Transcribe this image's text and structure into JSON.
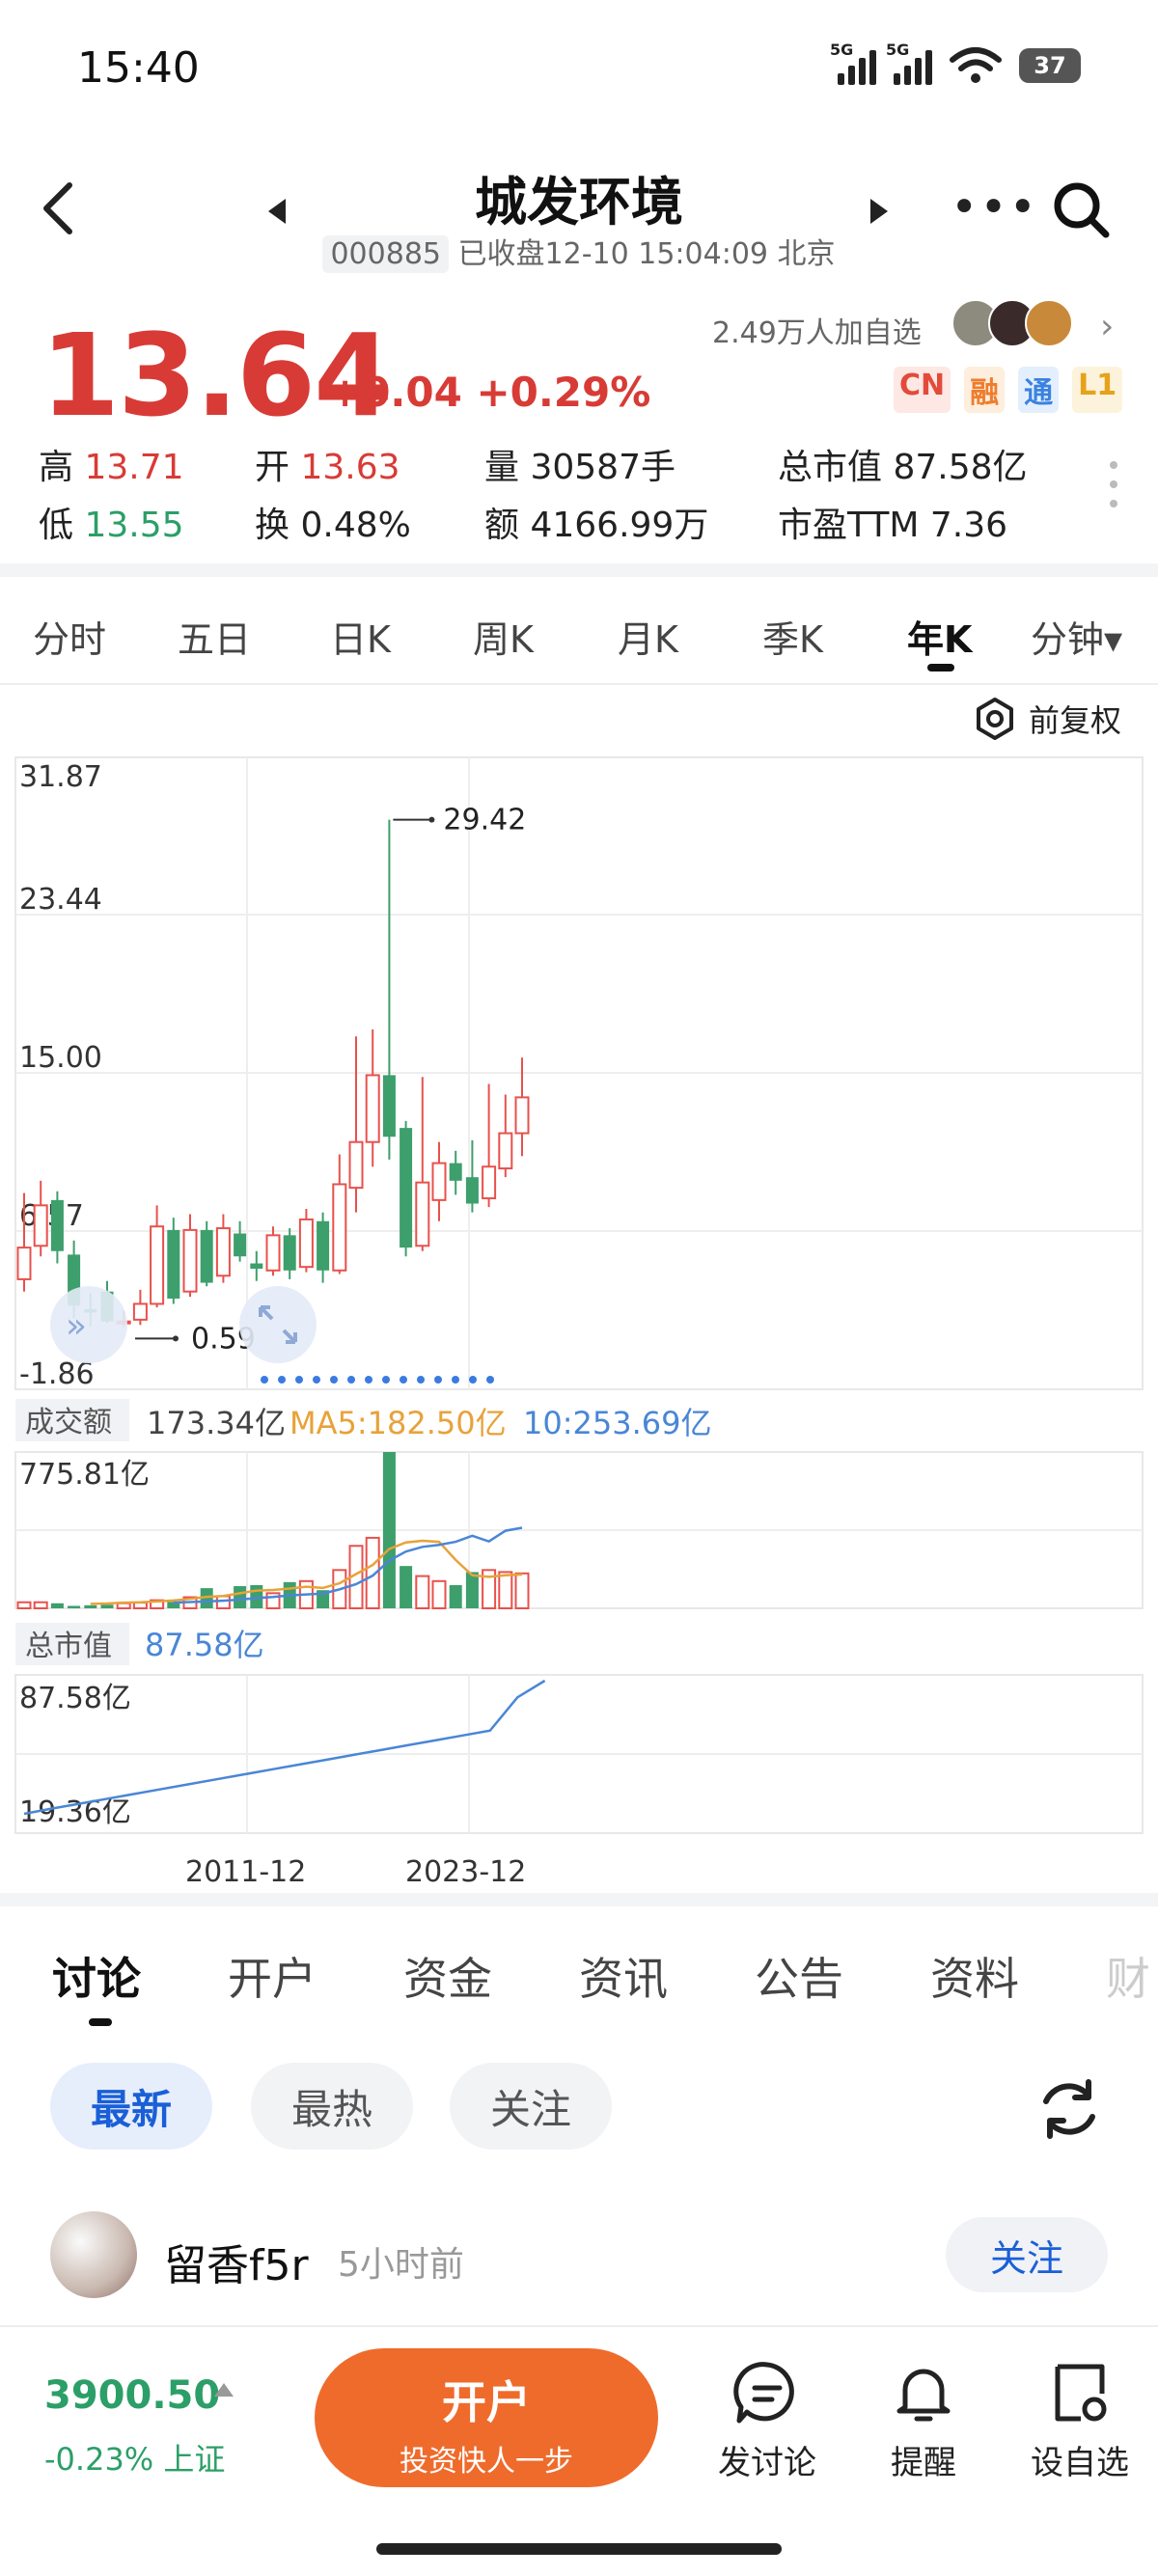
{
  "status_bar": {
    "time": "15:40",
    "signal1": "5G",
    "signal2": "5G",
    "battery": "37"
  },
  "header": {
    "title": "城发环境",
    "code": "000885",
    "status": "已收盘12-10 15:04:09 北京"
  },
  "quote": {
    "price": "13.64",
    "change": "+0.04 +0.29%",
    "watchers": "2.49万人加自选",
    "badges": [
      "CN",
      "融",
      "通",
      "L1"
    ],
    "stats": {
      "high_label": "高",
      "high": "13.71",
      "low_label": "低",
      "low": "13.55",
      "open_label": "开",
      "open": "13.63",
      "turnover_label": "换",
      "turnover": "0.48%",
      "volume_label": "量",
      "volume": "30587手",
      "amount_label": "额",
      "amount": "4166.99万",
      "mcap_label": "总市值",
      "mcap": "87.58亿",
      "pe_label": "市盈TTM",
      "pe": "7.36"
    }
  },
  "period_tabs": [
    "分时",
    "五日",
    "日K",
    "周K",
    "月K",
    "季K",
    "年K",
    "分钟▾"
  ],
  "active_period": "年K",
  "adjust_label": "前复权",
  "chart_data": {
    "type": "candlestick",
    "price_axis": {
      "ticks": [
        "31.87",
        "23.44",
        "15.00",
        "6.57",
        "-1.86"
      ],
      "ylim": [
        -1.86,
        31.87
      ]
    },
    "max_label": "29.42",
    "min_label": "0.59",
    "candles": [
      {
        "o": 3.3,
        "c": 5.1,
        "h": 8.2,
        "l": 2.6,
        "dir": "up"
      },
      {
        "o": 5.2,
        "c": 7.5,
        "h": 8.9,
        "l": 4.6,
        "dir": "up"
      },
      {
        "o": 7.8,
        "c": 4.9,
        "h": 8.3,
        "l": 4.2,
        "dir": "down"
      },
      {
        "o": 4.7,
        "c": 1.8,
        "h": 5.5,
        "l": 1.1,
        "dir": "down"
      },
      {
        "o": 1.6,
        "c": 1.4,
        "h": 2.5,
        "l": 0.6,
        "dir": "down"
      },
      {
        "o": 2.6,
        "c": 0.9,
        "h": 3.2,
        "l": 0.8,
        "dir": "down"
      },
      {
        "o": 0.8,
        "c": 0.9,
        "h": 1.5,
        "l": 0.6,
        "dir": "up"
      },
      {
        "o": 1.0,
        "c": 1.9,
        "h": 2.7,
        "l": 0.7,
        "dir": "up"
      },
      {
        "o": 1.9,
        "c": 6.3,
        "h": 7.5,
        "l": 1.7,
        "dir": "up"
      },
      {
        "o": 6.1,
        "c": 2.2,
        "h": 6.8,
        "l": 1.9,
        "dir": "down"
      },
      {
        "o": 2.6,
        "c": 6.1,
        "h": 7.0,
        "l": 2.3,
        "dir": "up"
      },
      {
        "o": 6.1,
        "c": 3.1,
        "h": 6.6,
        "l": 2.9,
        "dir": "down"
      },
      {
        "o": 3.5,
        "c": 6.2,
        "h": 7.0,
        "l": 3.1,
        "dir": "up"
      },
      {
        "o": 5.9,
        "c": 4.6,
        "h": 6.6,
        "l": 4.3,
        "dir": "down"
      },
      {
        "o": 4.2,
        "c": 3.9,
        "h": 4.9,
        "l": 3.2,
        "dir": "down"
      },
      {
        "o": 3.8,
        "c": 5.8,
        "h": 6.3,
        "l": 3.5,
        "dir": "up"
      },
      {
        "o": 5.8,
        "c": 3.8,
        "h": 6.2,
        "l": 3.3,
        "dir": "down"
      },
      {
        "o": 4.0,
        "c": 6.7,
        "h": 7.3,
        "l": 3.7,
        "dir": "up"
      },
      {
        "o": 6.6,
        "c": 3.8,
        "h": 7.1,
        "l": 3.1,
        "dir": "down"
      },
      {
        "o": 3.8,
        "c": 8.7,
        "h": 10.4,
        "l": 3.6,
        "dir": "up"
      },
      {
        "o": 8.5,
        "c": 11.1,
        "h": 17.1,
        "l": 7.1,
        "dir": "up"
      },
      {
        "o": 11.1,
        "c": 14.9,
        "h": 17.5,
        "l": 9.7,
        "dir": "up"
      },
      {
        "o": 14.9,
        "c": 11.4,
        "h": 29.42,
        "l": 10.1,
        "dir": "down"
      },
      {
        "o": 11.9,
        "c": 5.1,
        "h": 12.3,
        "l": 4.6,
        "dir": "down"
      },
      {
        "o": 5.2,
        "c": 8.8,
        "h": 14.8,
        "l": 4.9,
        "dir": "up"
      },
      {
        "o": 7.8,
        "c": 9.9,
        "h": 11.1,
        "l": 6.6,
        "dir": "up"
      },
      {
        "o": 9.9,
        "c": 8.9,
        "h": 10.6,
        "l": 8.1,
        "dir": "down"
      },
      {
        "o": 9.1,
        "c": 7.6,
        "h": 11.2,
        "l": 7.1,
        "dir": "down"
      },
      {
        "o": 7.9,
        "c": 9.7,
        "h": 14.4,
        "l": 7.4,
        "dir": "up"
      },
      {
        "o": 9.6,
        "c": 11.6,
        "h": 13.8,
        "l": 9.1,
        "dir": "up"
      },
      {
        "o": 11.6,
        "c": 13.64,
        "h": 15.9,
        "l": 10.3,
        "dir": "up"
      }
    ],
    "turnover": {
      "label": "成交额",
      "value": "173.34亿",
      "ma5": "MA5:182.50亿",
      "ma10": "10:253.69亿",
      "axis_top": "775.81亿",
      "ylim": [
        0,
        775.81
      ],
      "bars": [
        30,
        30,
        25,
        12,
        15,
        18,
        25,
        28,
        40,
        32,
        55,
        100,
        60,
        110,
        115,
        75,
        130,
        135,
        90,
        190,
        310,
        350,
        775.81,
        210,
        160,
        135,
        115,
        180,
        190,
        180,
        173.34
      ],
      "ma5_line": [
        null,
        null,
        null,
        null,
        22,
        24,
        28,
        30,
        34,
        39,
        47,
        57,
        61,
        75,
        88,
        91,
        98,
        107,
        101,
        124,
        170,
        215,
        295,
        327,
        335,
        330,
        240,
        164,
        156,
        164,
        168
      ],
      "ma10_line": [
        null,
        null,
        null,
        null,
        null,
        null,
        null,
        null,
        null,
        28,
        31,
        34,
        38,
        43,
        51,
        56,
        64,
        69,
        73,
        94,
        120,
        162,
        237,
        282,
        305,
        315,
        330,
        360,
        332,
        385,
        400
      ]
    },
    "market_cap": {
      "label": "总市值",
      "value": "87.58亿",
      "axis_top": "87.58亿",
      "axis_bottom": "19.36亿",
      "ylim": [
        19.36,
        87.58
      ],
      "line": [
        19.36,
        22.0,
        24.5,
        27.0,
        29.5,
        32.0,
        34.5,
        37.0,
        39.5,
        42.0,
        44.5,
        47.0,
        49.5,
        52.0,
        54.5,
        57.0,
        59.5,
        62.0,
        79.0,
        87.58
      ],
      "line_x_index": [
        0,
        2,
        4,
        6,
        8,
        10,
        12,
        14,
        16,
        18,
        20,
        22,
        24,
        26,
        28,
        30,
        32,
        34,
        36,
        38
      ]
    },
    "x_ticks": [
      "2011-12",
      "2023-12"
    ]
  },
  "bottom_tabs": [
    "讨论",
    "开户",
    "资金",
    "资讯",
    "公告",
    "资料",
    "财"
  ],
  "filter_pills": [
    "最新",
    "最热",
    "关注"
  ],
  "post": {
    "user": "留香f5r",
    "time": "5小时前",
    "follow": "关注"
  },
  "bottom_bar": {
    "index_value": "3900.50",
    "index_change": "-0.23% 上证",
    "open_title": "开户",
    "open_sub": "投资快人一步",
    "post_label": "发讨论",
    "remind_label": "提醒",
    "watch_label": "设自选"
  },
  "colors": {
    "up": "#e8514c",
    "down": "#3d9f6c",
    "ma5": "#e8a23a",
    "ma10": "#4a86d6",
    "accent": "#ef6b2c"
  }
}
